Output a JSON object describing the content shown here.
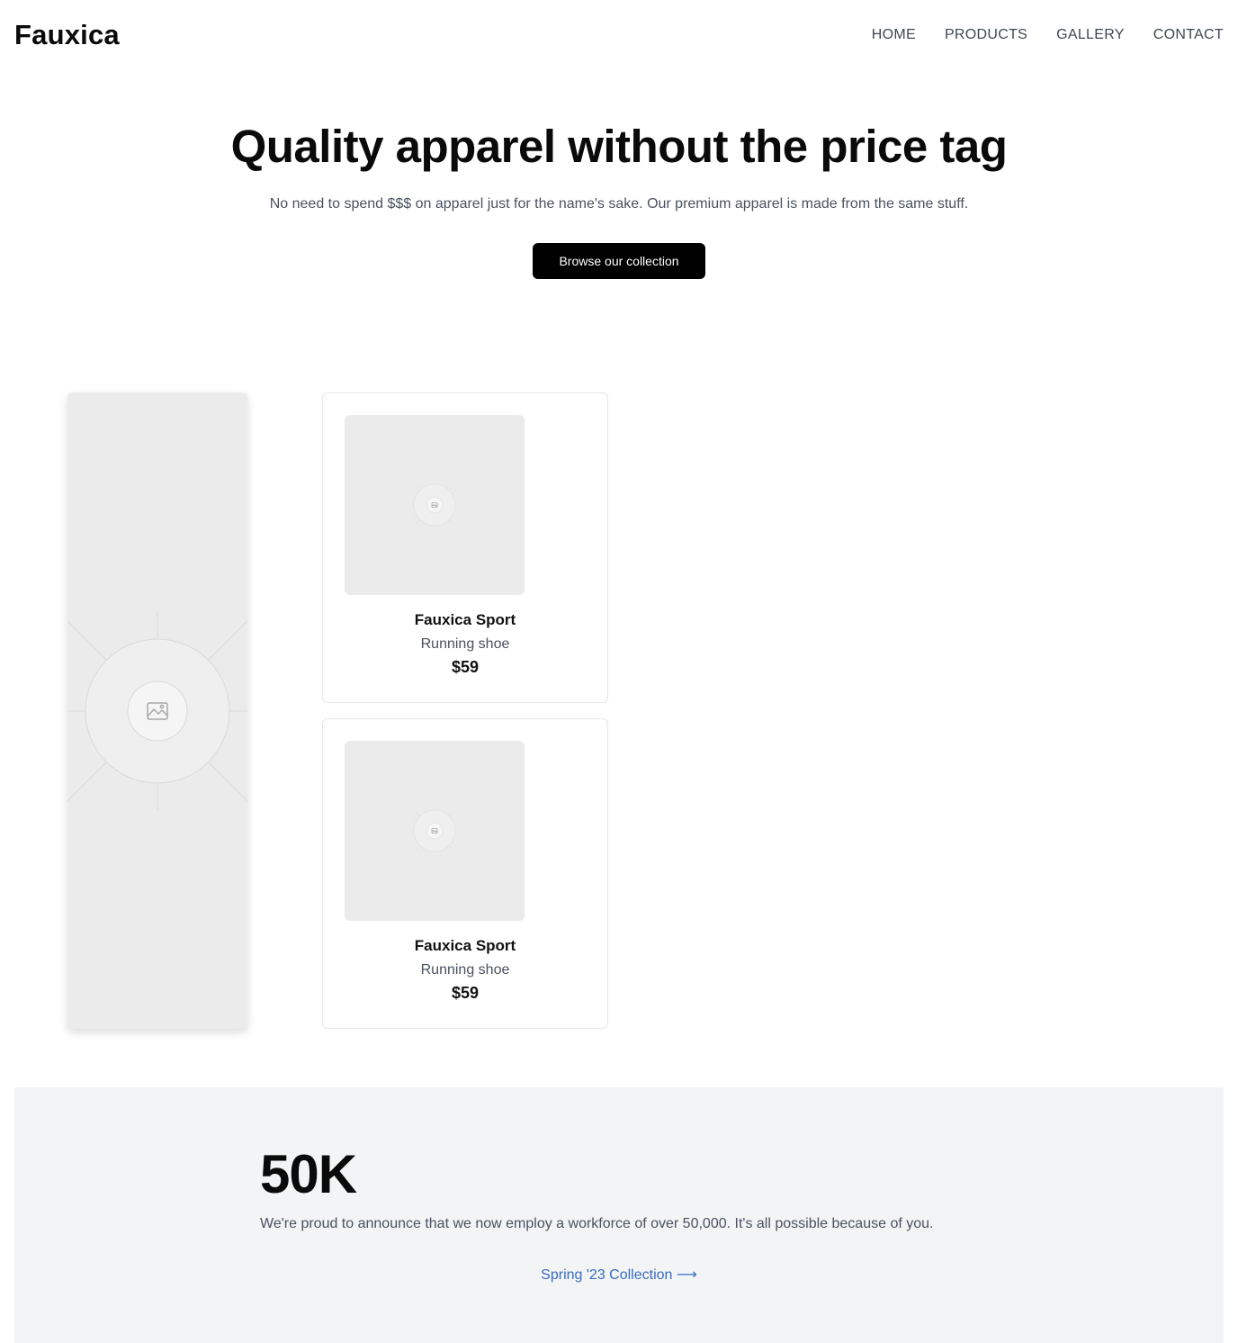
{
  "header": {
    "logo": "Fauxica",
    "nav": [
      "HOME",
      "PRODUCTS",
      "GALLERY",
      "CONTACT"
    ]
  },
  "hero": {
    "title": "Quality apparel without the price tag",
    "subtitle": "No need to spend $$$ on apparel just for the name's sake. Our premium apparel is made from the same stuff.",
    "cta_label": "Browse our collection"
  },
  "products": [
    {
      "name": "Fauxica Sport",
      "type": "Running shoe",
      "price": "$59"
    },
    {
      "name": "Fauxica Sport",
      "type": "Running shoe",
      "price": "$59"
    }
  ],
  "stats": {
    "value": "50K",
    "description": "We're proud to announce that we now employ a workforce of over 50,000. It's all possible because of you.",
    "link_label": "Spring '23 Collection ⟶"
  },
  "colors": {
    "primary_button": "#000000",
    "link": "#3b6bbf",
    "placeholder": "#ebebeb",
    "section_bg": "#f2f4f6"
  }
}
